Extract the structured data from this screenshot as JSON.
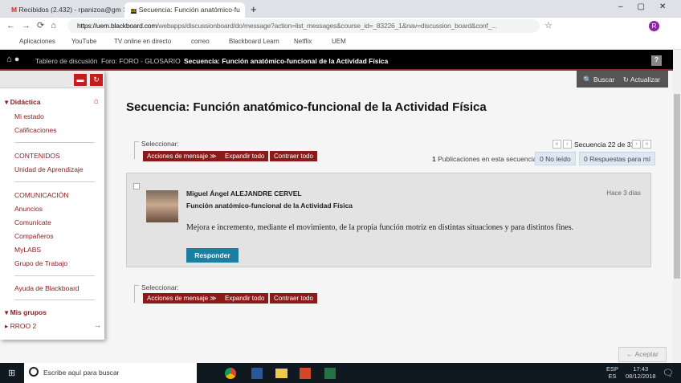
{
  "browser": {
    "tabs": [
      {
        "label": "Recibidos (2.432) - rpanizoa@gm"
      },
      {
        "label": "Secuencia: Función anatómico-fu"
      }
    ],
    "url_host": "https://uem.blackboard.com",
    "url_path": "/webapps/discussionboard/do/message?action=list_messages&course_id=_83226_1&nav=discussion_board&conf_...",
    "bookmarks": [
      "Aplicaciones",
      "YouTube",
      "TV online en directo",
      "correo",
      "Blackboard Learn",
      "Netflix",
      "UEM"
    ],
    "profile": "R"
  },
  "breadcrumbs": [
    "Tablero de discusión",
    "Foro: FORO - GLOSARIO",
    "Secuencia: Función anatómico-funcional de la Actividad Física"
  ],
  "help": "?",
  "toolbar": {
    "search": "Buscar",
    "refresh": "Actualizar"
  },
  "sidebar": {
    "sections": [
      {
        "title": "Didáctica",
        "items": [
          "Mi estado",
          "Calificaciones"
        ]
      },
      {
        "title": "CONTENIDOS",
        "items": [
          "Unidad de Aprendizaje"
        ]
      },
      {
        "title": "COMUNICACIÓN",
        "items": [
          "Anuncios",
          "Comunícate",
          "Compañeros",
          "MyLABS",
          "Grupo de Trabajo"
        ]
      },
      {
        "title": "",
        "items": [
          "Ayuda de Blackboard"
        ]
      },
      {
        "title": "Mis grupos",
        "items": [
          "RROO 2"
        ]
      }
    ]
  },
  "main": {
    "title": "Secuencia: Función anatómico-funcional de la Actividad Física",
    "select_label": "Seleccionar:",
    "actions": "Acciones de mensaje",
    "expand": "Expandir todo",
    "collapse": "Contraer todo",
    "sequence": "Secuencia 22 de 31",
    "post_count": "1",
    "post_label": "Publicaciones en esta secuencia",
    "unread": "0 No leído",
    "replies": "0 Respuestas para mí",
    "message": {
      "author": "Miguel Ángel ALEJANDRE CERVEL",
      "subject": "Función anatómico-funcional de la Actividad Física",
      "time": "Hace 3 días",
      "body": "Mejora e incremento, mediante el movimiento, de la propia función motriz en distintas situaciones y para distintos fines.",
      "reply": "Responder"
    },
    "accept": "← Aceptar"
  },
  "taskbar": {
    "search": "Escribe aquí para buscar",
    "lang1": "ESP",
    "lang2": "ES",
    "time": "17:43",
    "date": "08/12/2018"
  }
}
